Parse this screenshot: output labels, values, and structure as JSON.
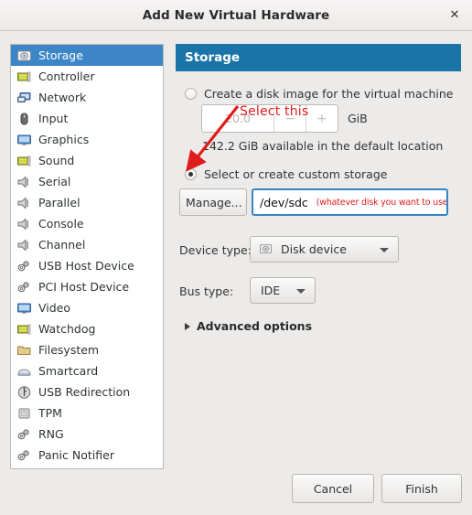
{
  "window": {
    "title": "Add New Virtual Hardware",
    "close_label": "✕"
  },
  "sidebar": {
    "items": [
      {
        "label": "Storage",
        "icon": "storage-icon",
        "selected": true
      },
      {
        "label": "Controller",
        "icon": "controller-icon",
        "selected": false
      },
      {
        "label": "Network",
        "icon": "network-icon",
        "selected": false
      },
      {
        "label": "Input",
        "icon": "input-mouse-icon",
        "selected": false
      },
      {
        "label": "Graphics",
        "icon": "graphics-monitor-icon",
        "selected": false
      },
      {
        "label": "Sound",
        "icon": "sound-card-icon",
        "selected": false
      },
      {
        "label": "Serial",
        "icon": "serial-port-icon",
        "selected": false
      },
      {
        "label": "Parallel",
        "icon": "parallel-port-icon",
        "selected": false
      },
      {
        "label": "Console",
        "icon": "console-port-icon",
        "selected": false
      },
      {
        "label": "Channel",
        "icon": "channel-port-icon",
        "selected": false
      },
      {
        "label": "USB Host Device",
        "icon": "usb-host-gears-icon",
        "selected": false
      },
      {
        "label": "PCI Host Device",
        "icon": "pci-host-gears-icon",
        "selected": false
      },
      {
        "label": "Video",
        "icon": "video-monitor-icon",
        "selected": false
      },
      {
        "label": "Watchdog",
        "icon": "watchdog-card-icon",
        "selected": false
      },
      {
        "label": "Filesystem",
        "icon": "folder-icon",
        "selected": false
      },
      {
        "label": "Smartcard",
        "icon": "smartcard-icon",
        "selected": false
      },
      {
        "label": "USB Redirection",
        "icon": "usb-redirection-icon",
        "selected": false
      },
      {
        "label": "TPM",
        "icon": "tpm-chip-icon",
        "selected": false
      },
      {
        "label": "RNG",
        "icon": "rng-gears-icon",
        "selected": false
      },
      {
        "label": "Panic Notifier",
        "icon": "panic-gears-icon",
        "selected": false
      }
    ]
  },
  "pane": {
    "header": "Storage",
    "create_disk": {
      "radio_label": "Create a disk image for the virtual machine",
      "selected": false,
      "size_value": "20.0",
      "minus_label": "−",
      "plus_label": "+",
      "unit_label": "GiB",
      "available_text": "142.2 GiB available in the default location"
    },
    "custom_storage": {
      "radio_label": "Select or create custom storage",
      "selected": true,
      "manage_label": "Manage...",
      "path_value": "/dev/sdc",
      "path_placeholder": "",
      "path_note": "(whatever disk you want to use)"
    },
    "device_type": {
      "label": "Device type:",
      "value": "Disk device"
    },
    "bus_type": {
      "label": "Bus type:",
      "value": "IDE"
    },
    "advanced_options": {
      "label": "Advanced options",
      "expanded": false
    }
  },
  "footer": {
    "cancel_label": "Cancel",
    "finish_label": "Finish"
  },
  "annotations": {
    "select_this": "Select this",
    "arrow_color": "#e01b1b"
  },
  "colors": {
    "header_blue": "#1a74a8",
    "selection_blue": "#3c86c8",
    "focus_border": "#3584c8",
    "annotation_red": "#e01b1b"
  }
}
